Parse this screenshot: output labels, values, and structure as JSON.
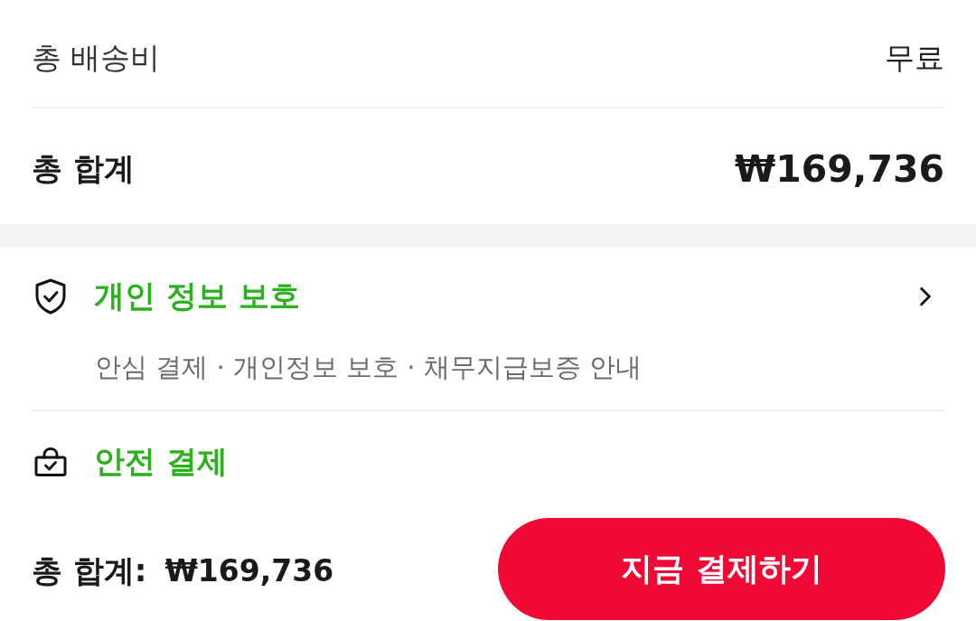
{
  "summary": [
    {
      "kind": "regular",
      "label": "총 배송비",
      "value": "무료"
    },
    {
      "kind": "total",
      "label": "총 합계",
      "value": "₩169,736"
    }
  ],
  "info_sections": [
    {
      "kind": "privacy",
      "title": "개인 정보 보호",
      "description": "안심 결제 · 개인정보 보호 · 채무지급보증 안내"
    },
    {
      "kind": "payment",
      "title": "안전 결제"
    }
  ],
  "bottom_bar": {
    "total_label": "총 합계:",
    "total_value": "₩169,736",
    "pay_button": "지금 결제하기"
  }
}
